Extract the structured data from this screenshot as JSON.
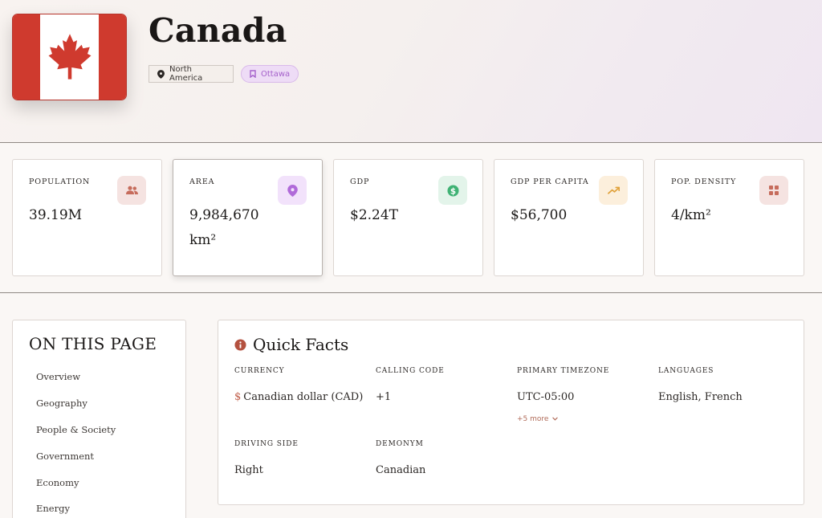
{
  "country": {
    "name": "Canada",
    "region": "North America",
    "capital": "Ottawa"
  },
  "colors": {
    "flag_red": "#cf3a2e",
    "population_badge": "#f5e3e1",
    "area_badge": "#f2e2fb",
    "gdp_badge": "#e3f4ea",
    "gdp_per_capita_badge": "#fcefdc",
    "density_badge": "#f5e3e1"
  },
  "stats": [
    {
      "label": "POPULATION",
      "value": "39.19M",
      "icon": "users-icon"
    },
    {
      "label": "AREA",
      "value": "9,984,670 km²",
      "icon": "location-pin-icon"
    },
    {
      "label": "GDP",
      "value": "$2.24T",
      "icon": "dollar-icon"
    },
    {
      "label": "GDP PER CAPITA",
      "value": "$56,700",
      "icon": "trending-up-icon"
    },
    {
      "label": "POP. DENSITY",
      "value": "4/km²",
      "icon": "grid-icon"
    }
  ],
  "toc": {
    "title": "ON THIS PAGE",
    "items": [
      "Overview",
      "Geography",
      "People & Society",
      "Government",
      "Economy",
      "Energy"
    ]
  },
  "quick_facts": {
    "title": "Quick Facts",
    "currency": {
      "label": "CURRENCY",
      "symbol": "$",
      "value": "Canadian dollar (CAD)"
    },
    "calling_code": {
      "label": "CALLING CODE",
      "value": "+1"
    },
    "timezone": {
      "label": "PRIMARY TIMEZONE",
      "value": "UTC-05:00",
      "more": "+5 more"
    },
    "languages": {
      "label": "LANGUAGES",
      "value": "English, French"
    },
    "driving_side": {
      "label": "DRIVING SIDE",
      "value": "Right"
    },
    "demonym": {
      "label": "DEMONYM",
      "value": "Canadian"
    }
  }
}
